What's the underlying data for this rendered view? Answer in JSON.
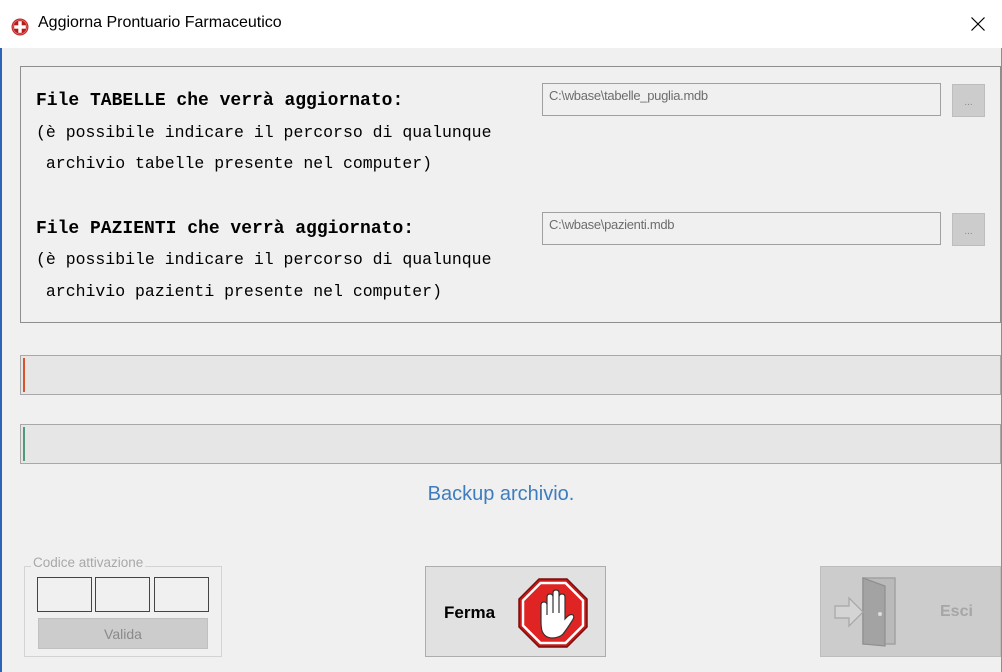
{
  "window": {
    "title": "Aggiorna Prontuario Farmaceutico",
    "close_glyph": "✕"
  },
  "tabelle": {
    "label": "File TABELLE che verrà aggiornato:",
    "note_line1": "(è possibile indicare il percorso di qualunque",
    "note_line2": " archivio tabelle presente nel computer)",
    "path": "C:\\wbase\\tabelle_puglia.mdb",
    "browse_label": "..."
  },
  "pazienti": {
    "label": "File PAZIENTI che verrà aggiornato:",
    "note_line1": "(è possibile indicare il percorso di qualunque",
    "note_line2": " archivio pazienti presente nel computer)",
    "path": "C:\\wbase\\pazienti.mdb",
    "browse_label": "..."
  },
  "progress": {
    "bar1_value": 0,
    "bar2_value": 0,
    "bar1_color": "#d9532f",
    "bar2_color": "#4f9a78"
  },
  "status": {
    "text": "Backup archivio.",
    "color": "#3d7dbf"
  },
  "activation": {
    "legend": "Codice attivazione",
    "fields": [
      "",
      "",
      ""
    ],
    "validate_label": "Valida"
  },
  "buttons": {
    "stop_label": "Ferma",
    "exit_label": "Esci"
  },
  "icons": {
    "app": "red-cross-icon",
    "stop": "stop-hand-icon",
    "exit": "exit-door-icon"
  }
}
